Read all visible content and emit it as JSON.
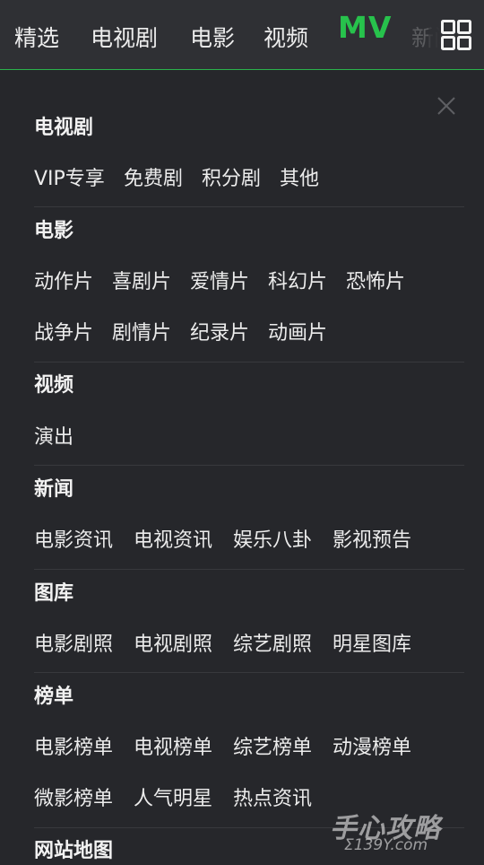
{
  "top_tabs": [
    "精选",
    "电视剧",
    "电影",
    "视频",
    "MV",
    "新闻"
  ],
  "sections": [
    {
      "title": "电视剧",
      "rows": [
        [
          "VIP专享",
          "免费剧",
          "积分剧",
          "其他"
        ]
      ]
    },
    {
      "title": "电影",
      "rows": [
        [
          "动作片",
          "喜剧片",
          "爱情片",
          "科幻片",
          "恐怖片"
        ],
        [
          "战争片",
          "剧情片",
          "纪录片",
          "动画片"
        ]
      ]
    },
    {
      "title": "视频",
      "rows": [
        [
          "演出"
        ]
      ]
    },
    {
      "title": "新闻",
      "rows": [
        [
          "电影资讯",
          "电视资讯",
          "娱乐八卦",
          "影视预告"
        ]
      ]
    },
    {
      "title": "图库",
      "rows": [
        [
          "电影剧照",
          "电视剧照",
          "综艺剧照",
          "明星图库"
        ]
      ]
    },
    {
      "title": "榜单",
      "rows": [
        [
          "电影榜单",
          "电视榜单",
          "综艺榜单",
          "动漫榜单"
        ],
        [
          "微影榜单",
          "人气明星",
          "热点资讯"
        ]
      ]
    },
    {
      "title": "网站地图",
      "rows": []
    }
  ],
  "watermark": {
    "main": "手心攻略",
    "sub": "Σ139Y.com"
  },
  "colors": {
    "accent": "#27c24c",
    "background": "#26272b",
    "topbar": "#2f3034"
  },
  "icons": {
    "menu": "grid-icon",
    "close": "close-icon"
  }
}
